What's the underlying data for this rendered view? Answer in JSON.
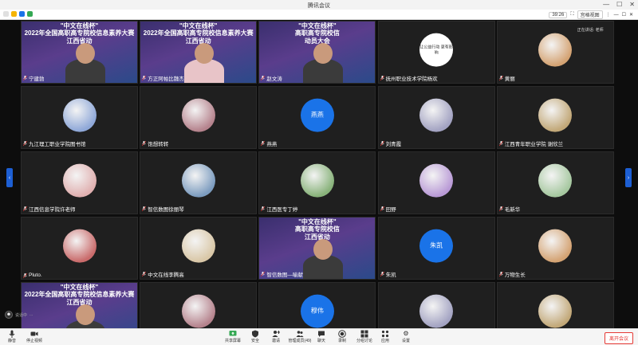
{
  "window": {
    "title": "腾讯会议",
    "minimize": "—",
    "maximize": "☐",
    "close": "✕"
  },
  "infobar": {
    "timer": "39:26",
    "view_label": "宫格视图",
    "more": "⋮",
    "min2": "—",
    "max2": "☐",
    "close2": "✕"
  },
  "tiles": [
    {
      "name": "宁建勃",
      "type": "video",
      "lines": [
        "\"中文在线杯\"",
        "2022年全国高职高专院校信息素养大赛",
        "江西省动"
      ]
    },
    {
      "name": "方正阿帕比魏杰",
      "type": "video",
      "lines": [
        "\"中文在线杯\"",
        "2022年全国高职高专院校信息素养大赛",
        "江西省动"
      ]
    },
    {
      "name": "赵文涛",
      "type": "video",
      "lines": [
        "\"中文在线杯\"",
        "高职高专院校信",
        "动员大会"
      ]
    },
    {
      "name": "抚州职业技术学院杨欢",
      "type": "avatar",
      "avatar_label": "让公益行动 更有影响"
    },
    {
      "name": "黄丽",
      "type": "avatar",
      "overlay": "正在讲话: 老师"
    },
    {
      "name": "九江理工职业学院图书馆",
      "type": "avatar"
    },
    {
      "name": "饱想转转",
      "type": "avatar"
    },
    {
      "name": "燕燕",
      "type": "text",
      "avatar_label": "燕燕"
    },
    {
      "name": "刘青霞",
      "type": "avatar"
    },
    {
      "name": "江西青年职业学院 谢欣兰",
      "type": "avatar"
    },
    {
      "name": "江西信息学院许老师",
      "type": "avatar"
    },
    {
      "name": "智信数图徐丽琴",
      "type": "avatar"
    },
    {
      "name": "江西医专丁婷",
      "type": "avatar"
    },
    {
      "name": "田野",
      "type": "avatar"
    },
    {
      "name": "毛新华",
      "type": "avatar"
    },
    {
      "name": "Pluto.",
      "type": "avatar"
    },
    {
      "name": "中文在线李腾高",
      "type": "avatar"
    },
    {
      "name": "智信数图—喻献",
      "type": "video",
      "lines": [
        "\"中文在线杯\"",
        "高职高专院校信",
        "江西省动"
      ]
    },
    {
      "name": "朱凯",
      "type": "text",
      "avatar_label": "朱凯"
    },
    {
      "name": "万物生长",
      "type": "avatar"
    },
    {
      "name": "",
      "type": "video",
      "lines": [
        "\"中文在线杯\"",
        "2022年全国高职高专院校信息素养大赛",
        "江西省动"
      ]
    },
    {
      "name": "",
      "type": "avatar"
    },
    {
      "name": "",
      "type": "text",
      "avatar_label": "穆伟"
    },
    {
      "name": "",
      "type": "avatar"
    },
    {
      "name": "",
      "type": "avatar"
    }
  ],
  "mini": {
    "label": "说话中",
    "suffix": "..."
  },
  "toolbar": {
    "mute": "静音",
    "video": "停止视频",
    "share": "共享屏幕",
    "security": "安全",
    "invite": "邀请",
    "members": "管理成员(49)",
    "chat": "聊天",
    "record": "录制",
    "rooms": "分组讨论",
    "apps": "应用",
    "settings": "设置",
    "leave": "离开会议"
  },
  "colors": {
    "accent": "#1a73e8",
    "leave": "#e53935",
    "tile_bg": "#1f1f1f"
  }
}
